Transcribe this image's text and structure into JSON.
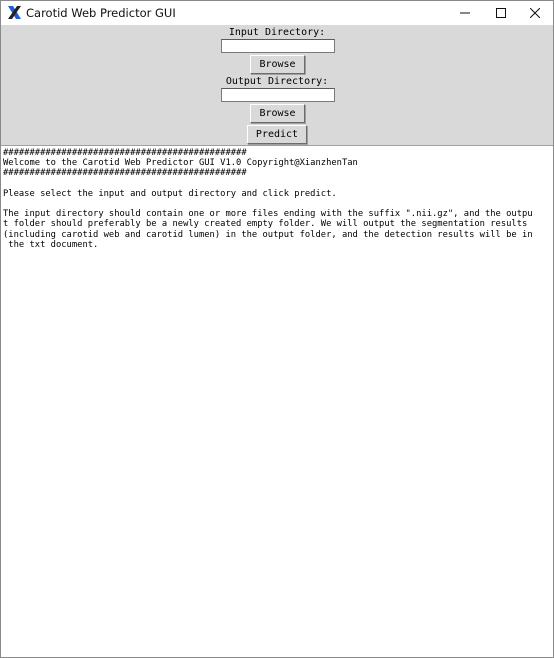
{
  "window": {
    "title": "Carotid Web Predictor GUI",
    "icon": "tk-feather-x-icon",
    "controls": [
      "minimize-icon",
      "maximize-icon",
      "close-icon"
    ]
  },
  "form": {
    "input_label": "Input Directory:",
    "input_value": "",
    "browse_input_label": "Browse",
    "output_label": "Output Directory:",
    "output_value": "",
    "browse_output_label": "Browse",
    "predict_label": "Predict"
  },
  "console": {
    "lines": [
      "##############################################",
      "Welcome to the Carotid Web Predictor GUI V1.0 Copyright@XianzhenTan",
      "##############################################",
      "",
      "Please select the input and output directory and click predict.",
      "",
      "The input directory should contain one or more files ending with the suffix \".nii.gz\", and the outpu",
      "t folder should preferably be a newly created empty folder. We will output the segmentation results",
      "(including carotid web and carotid lumen) in the output folder, and the detection results will be in",
      " the txt document."
    ]
  },
  "colors": {
    "form_background": "#d9d9d9",
    "console_background": "#ffffff",
    "icon_blue": "#1f5fd6",
    "icon_dark": "#222222"
  }
}
